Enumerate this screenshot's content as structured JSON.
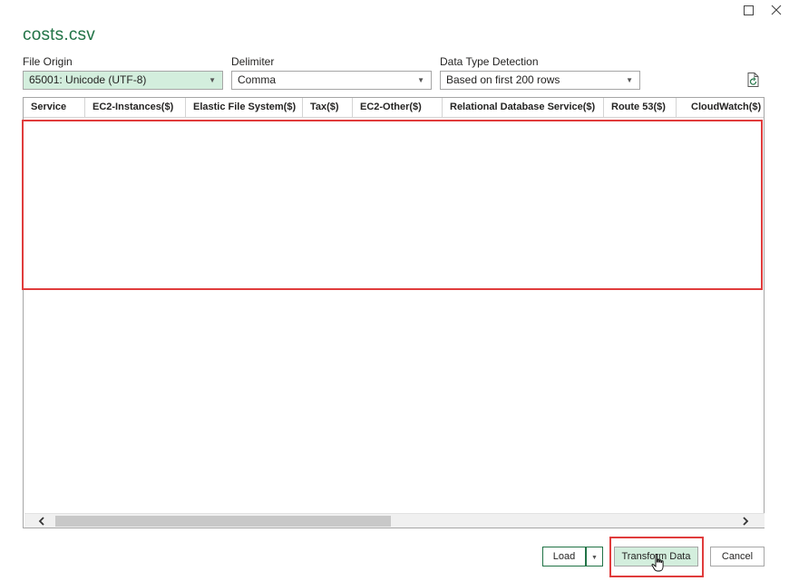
{
  "window": {
    "title": "costs.csv",
    "maximize_icon": "maximize-icon",
    "close_icon": "close-icon"
  },
  "options": {
    "file_origin": {
      "label": "File Origin",
      "value": "65001: Unicode (UTF-8)"
    },
    "delimiter": {
      "label": "Delimiter",
      "value": "Comma"
    },
    "data_type_detection": {
      "label": "Data Type Detection",
      "value": "Based on first 200 rows"
    },
    "refresh_icon": "refresh-document-icon"
  },
  "grid": {
    "columns": [
      "Service",
      "EC2-Instances($)",
      "Elastic File System($)",
      "Tax($)",
      "EC2-Other($)",
      "Relational Database Service($)",
      "Route 53($)",
      "CloudWatch($)"
    ],
    "rows": []
  },
  "buttons": {
    "load": "Load",
    "transform": "Transform Data",
    "cancel": "Cancel"
  },
  "colors": {
    "accent_green": "#217346",
    "selected_fill": "#d3eedd",
    "highlight_red": "#e03c3c"
  }
}
